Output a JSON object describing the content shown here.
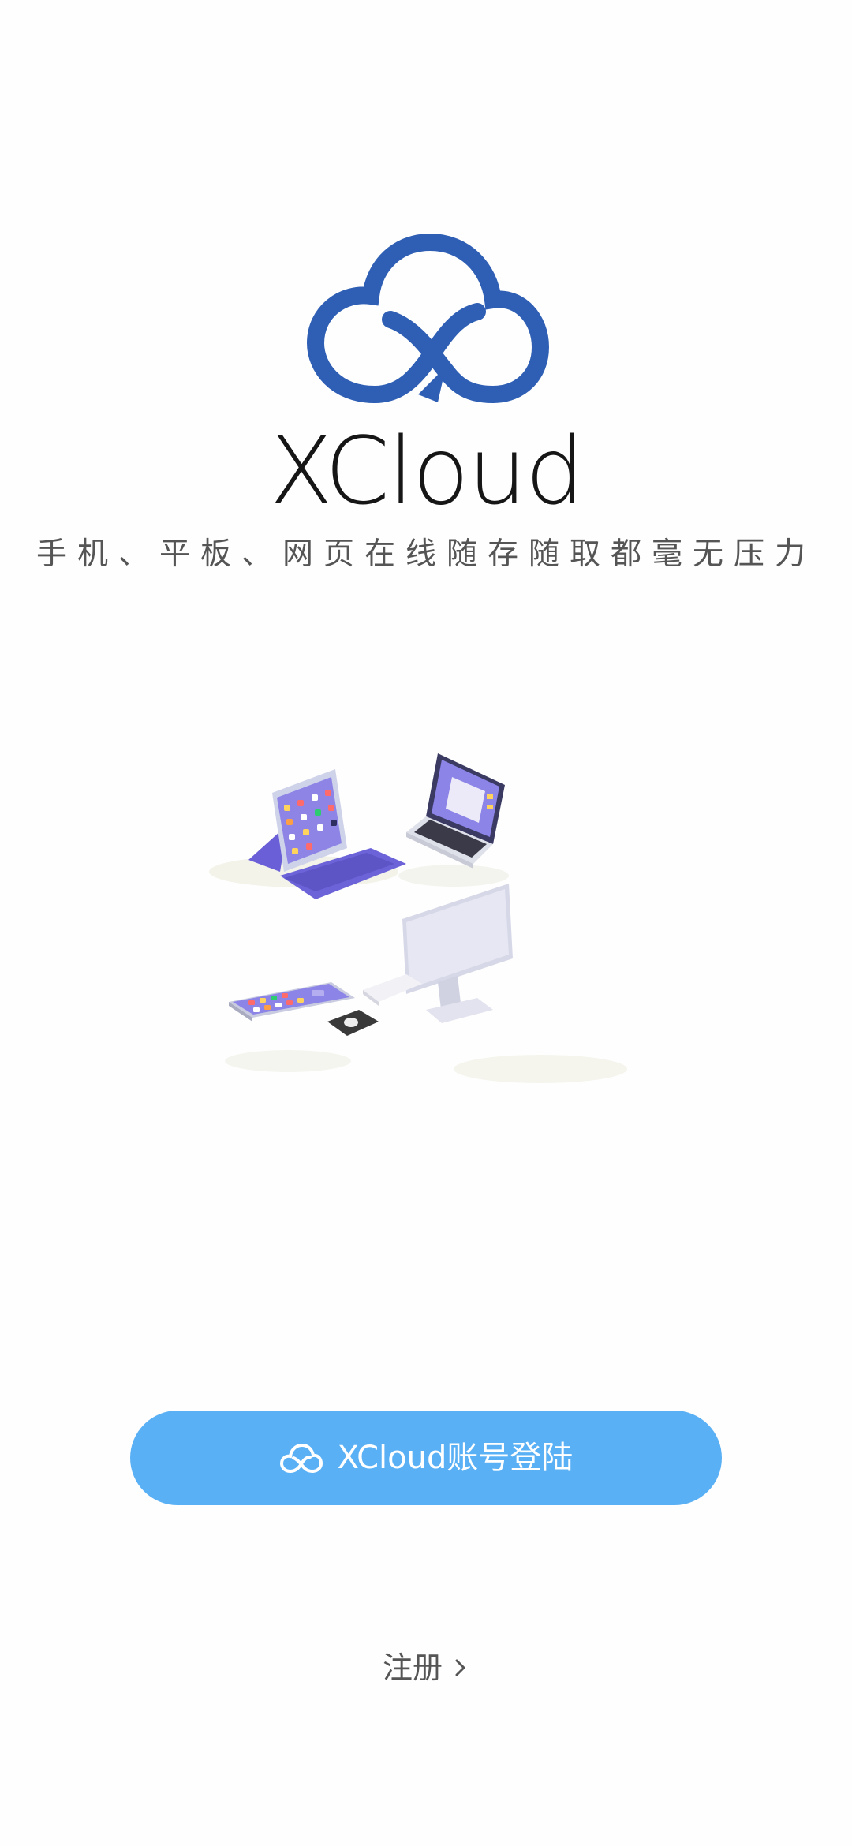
{
  "app": {
    "brand_name": "XCloud",
    "tagline": "手机、平板、网页在线随存随取都毫无压力",
    "logo_icon": "cloud-x-logo-icon",
    "accent_color": "#2f5fb4"
  },
  "illustration": {
    "icon": "devices-illustration",
    "devices": [
      "tablet",
      "laptop",
      "phone",
      "desktop"
    ]
  },
  "actions": {
    "login_label": "XCloud账号登陆",
    "login_icon": "cloud-icon",
    "login_color": "#5ab0f5",
    "register_label": "注册",
    "register_icon": "chevron-right-icon"
  }
}
